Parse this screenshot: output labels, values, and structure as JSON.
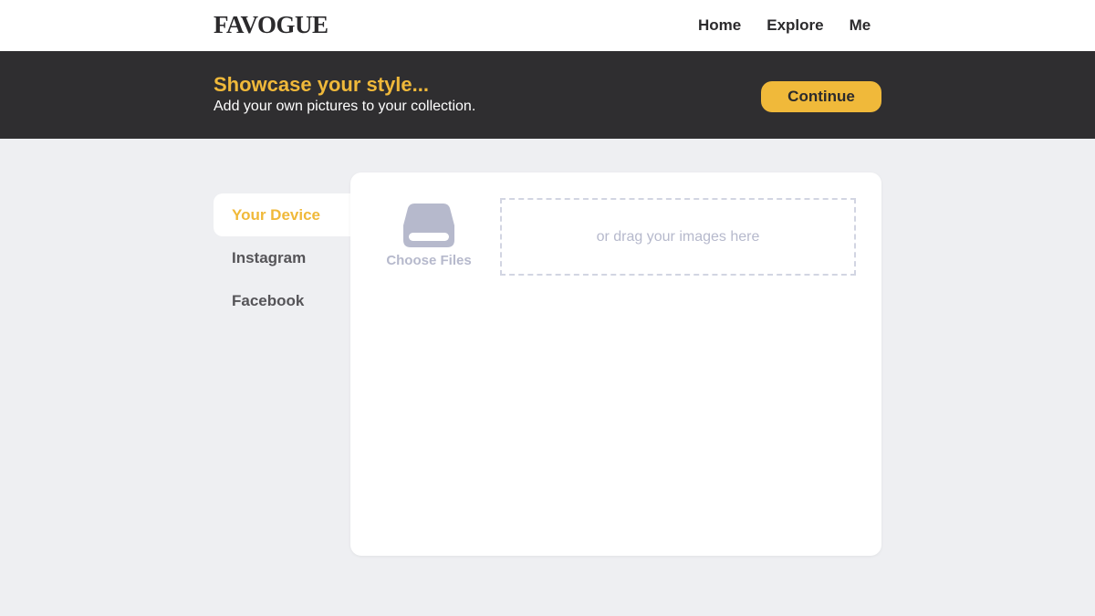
{
  "nav": {
    "logo": "FAVOGUE",
    "links": [
      "Home",
      "Explore",
      "Me"
    ]
  },
  "banner": {
    "title": "Showcase your style...",
    "subtitle": "Add your own pictures to your collection.",
    "continue_label": "Continue"
  },
  "tabs": [
    {
      "label": "Your Device",
      "active": true
    },
    {
      "label": "Instagram",
      "active": false
    },
    {
      "label": "Facebook",
      "active": false
    }
  ],
  "upload": {
    "icon": "hard-drive-icon",
    "choose_label": "Choose Files",
    "drop_hint": "or drag your images here"
  },
  "colors": {
    "accent": "#f0b93a",
    "banner_bg": "#2f2e30",
    "page_bg": "#eeeff2",
    "muted": "#b6b9cc"
  }
}
